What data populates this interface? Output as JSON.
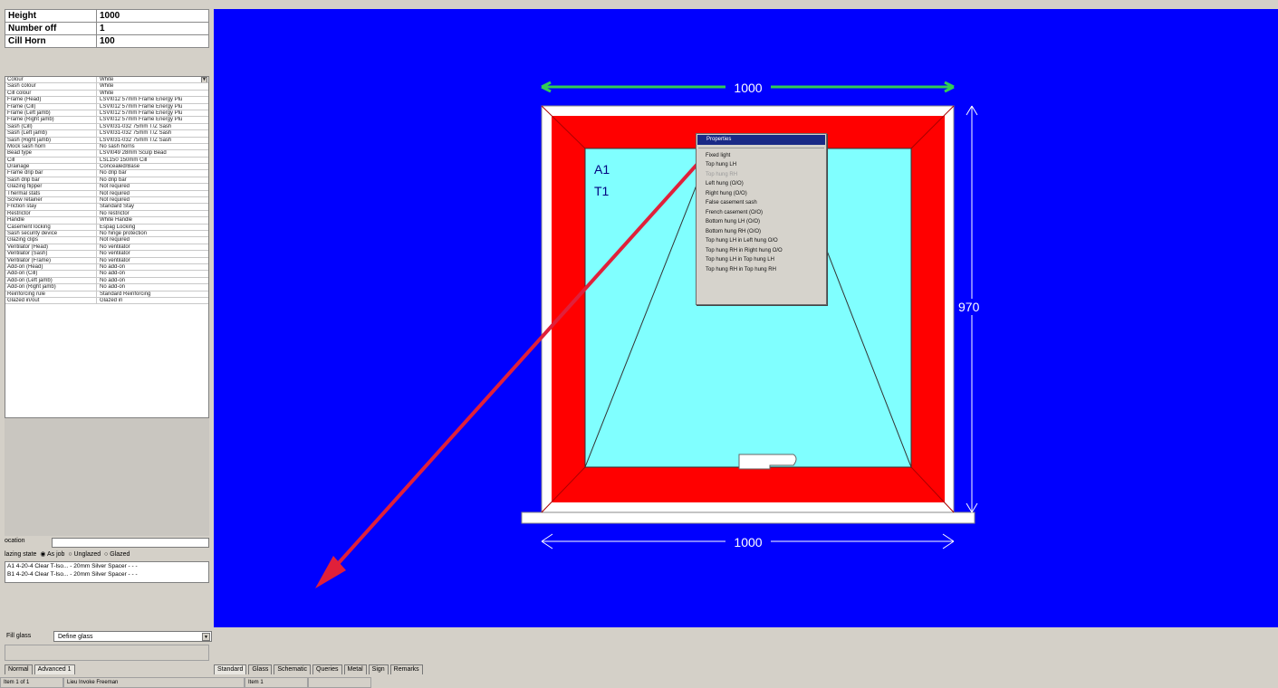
{
  "top_fields": [
    {
      "label": "Height",
      "value": "1000"
    },
    {
      "label": "Number off",
      "value": "1"
    },
    {
      "label": "Cill Horn",
      "value": "100"
    }
  ],
  "properties": [
    {
      "key": "Colour",
      "value": "White"
    },
    {
      "key": "Sash colour",
      "value": "White"
    },
    {
      "key": "Cill colour",
      "value": "White"
    },
    {
      "key": "Frame (Head)",
      "value": "LSVI012 57mm Frame Energy Plu"
    },
    {
      "key": "Frame (Cill)",
      "value": "LSVI012 57mm Frame Energy Plu"
    },
    {
      "key": "Frame (Left jamb)",
      "value": "LSVI012 57mm Frame Energy Plu"
    },
    {
      "key": "Frame (Right jamb)",
      "value": "LSVI012 57mm Frame Energy Plu"
    },
    {
      "key": "Sash (Cill)",
      "value": "LSVI031-032 75mm T/Z Sash"
    },
    {
      "key": "Sash (Left jamb)",
      "value": "LSVI031-032 75mm T/Z Sash"
    },
    {
      "key": "Sash (Right jamb)",
      "value": "LSVI031-032 75mm T/Z Sash"
    },
    {
      "key": "Mock sash horn",
      "value": "No sash horns"
    },
    {
      "key": "Bead type",
      "value": "LSVI049 28mm Sculp Bead"
    },
    {
      "key": "Cill",
      "value": "LSL150 150mm Cill"
    },
    {
      "key": "Drainage",
      "value": "Concealed/Base"
    },
    {
      "key": "Frame drip bar",
      "value": "No drip bar"
    },
    {
      "key": "Sash drip bar",
      "value": "No drip bar"
    },
    {
      "key": "Glazing flipper",
      "value": "Not required"
    },
    {
      "key": "Thermal stats",
      "value": "Not required"
    },
    {
      "key": "Screw retainer",
      "value": "Not required"
    },
    {
      "key": "Friction stay",
      "value": "Standard Stay"
    },
    {
      "key": "Restrictor",
      "value": "No restrictor"
    },
    {
      "key": "Handle",
      "value": "White Handle"
    },
    {
      "key": "Casement locking",
      "value": "Espag Locking"
    },
    {
      "key": "Sash security device",
      "value": "No hinge protection"
    },
    {
      "key": "Glazing clips",
      "value": "Not required"
    },
    {
      "key": "Ventilator (Head)",
      "value": "No ventilator"
    },
    {
      "key": "Ventilator (Sash)",
      "value": "No ventilator"
    },
    {
      "key": "Ventilator (Frame)",
      "value": "No ventilator"
    },
    {
      "key": "Add-on (Head)",
      "value": "No add-on"
    },
    {
      "key": "Add-on (Cill)",
      "value": "No add-on"
    },
    {
      "key": "Add-on (Left jamb)",
      "value": "No add-on"
    },
    {
      "key": "Add-on (Right jamb)",
      "value": "No add-on"
    },
    {
      "key": "Reinforcing rule",
      "value": "Standard Reinforcing"
    },
    {
      "key": "Glazed in/out",
      "value": "Glazed in"
    }
  ],
  "location": {
    "label": "ocation",
    "value": ""
  },
  "glazing_state": {
    "label": "lazing state",
    "options": [
      "As job",
      "Unglazed",
      "Glazed"
    ],
    "selected": "As job"
  },
  "glass_items": [
    {
      "code": "A1",
      "desc": "4-20-4 Clear T-Iso... - 20mm Silver Spacer - - -"
    },
    {
      "code": "B1",
      "desc": "4-20-4 Clear T-Iso... - 20mm Silver Spacer - - -"
    }
  ],
  "fill_glass": {
    "label": "Fill glass",
    "value": "Define glass"
  },
  "left_tabs": [
    "Normal",
    "Advanced 1"
  ],
  "bottom_tabs": [
    "Standard",
    "Glass",
    "Schematic",
    "Queries",
    "Metal",
    "Sign",
    "Remarks"
  ],
  "status_bar": [
    "Item 1 of 1",
    "Lieu Invoke Freeman",
    "Item 1",
    ""
  ],
  "drawing": {
    "width_top": "1000",
    "width_bottom": "1000",
    "height_right": "970",
    "sash_codes": [
      "A1",
      "T1"
    ],
    "colors": {
      "background": "#0000ff",
      "frame": "#ff0000",
      "glass": "#80ffff",
      "outer": "#ffffff",
      "arrow": "#e0203a",
      "dim_top": "#33cc55"
    }
  },
  "context_menu": [
    {
      "label": "Properties",
      "state": "selected"
    },
    {
      "label": "",
      "state": "separator"
    },
    {
      "label": "Fixed light",
      "state": "normal"
    },
    {
      "label": "Top hung LH",
      "state": "normal"
    },
    {
      "label": "Top hung RH",
      "state": "disabled"
    },
    {
      "label": "Left hung (O/O)",
      "state": "normal"
    },
    {
      "label": "Right hung (O/O)",
      "state": "normal"
    },
    {
      "label": "False casement sash",
      "state": "normal"
    },
    {
      "label": "French casement (O/O)",
      "state": "normal"
    },
    {
      "label": "Bottom hung LH (O/O)",
      "state": "normal"
    },
    {
      "label": "Bottom hung RH (O/O)",
      "state": "normal"
    },
    {
      "label": "Top hung LH in Left hung O/O",
      "state": "normal"
    },
    {
      "label": "Top hung RH in Right hung O/O",
      "state": "normal"
    },
    {
      "label": "Top hung LH in Top hung LH",
      "state": "normal"
    },
    {
      "label": "Top hung RH in Top hung RH",
      "state": "normal"
    }
  ]
}
